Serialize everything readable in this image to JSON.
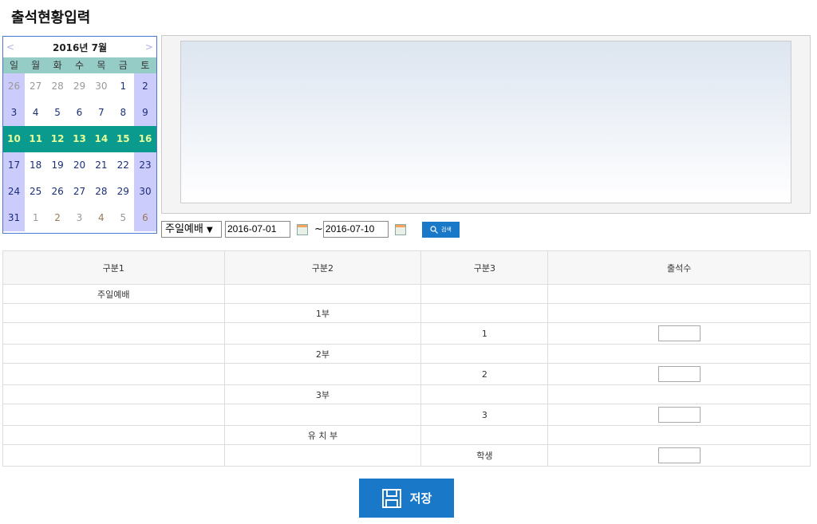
{
  "title": "출석현황입력",
  "calendar": {
    "month_label": "2016년 7월",
    "prev": "<",
    "next": ">",
    "weekdays": [
      "일",
      "월",
      "화",
      "수",
      "목",
      "금",
      "토"
    ],
    "weeks": [
      [
        "26",
        "27",
        "28",
        "29",
        "30",
        "1",
        "2"
      ],
      [
        "3",
        "4",
        "5",
        "6",
        "7",
        "8",
        "9"
      ],
      [
        "10",
        "11",
        "12",
        "13",
        "14",
        "15",
        "16"
      ],
      [
        "17",
        "18",
        "19",
        "20",
        "21",
        "22",
        "23"
      ],
      [
        "24",
        "25",
        "26",
        "27",
        "28",
        "29",
        "30"
      ],
      [
        "31",
        "1",
        "2",
        "3",
        "4",
        "5",
        "6"
      ]
    ]
  },
  "filter": {
    "service": "주일예배",
    "arrow": "▼",
    "start": "2016-07-01",
    "tilde": "~",
    "end": "2016-07-10",
    "search": "검색"
  },
  "table": {
    "headers": [
      "구분1",
      "구분2",
      "구분3",
      "출석수"
    ],
    "rows": [
      [
        "주일예배",
        "",
        "",
        ""
      ],
      [
        "",
        "1부",
        "",
        ""
      ],
      [
        "",
        "",
        "1",
        "input"
      ],
      [
        "",
        "2부",
        "",
        ""
      ],
      [
        "",
        "",
        "2",
        "input"
      ],
      [
        "",
        "3부",
        "",
        ""
      ],
      [
        "",
        "",
        "3",
        "input"
      ],
      [
        "",
        "유 치 부",
        "",
        ""
      ],
      [
        "",
        "",
        "학생",
        "input"
      ]
    ]
  },
  "save": "저장"
}
